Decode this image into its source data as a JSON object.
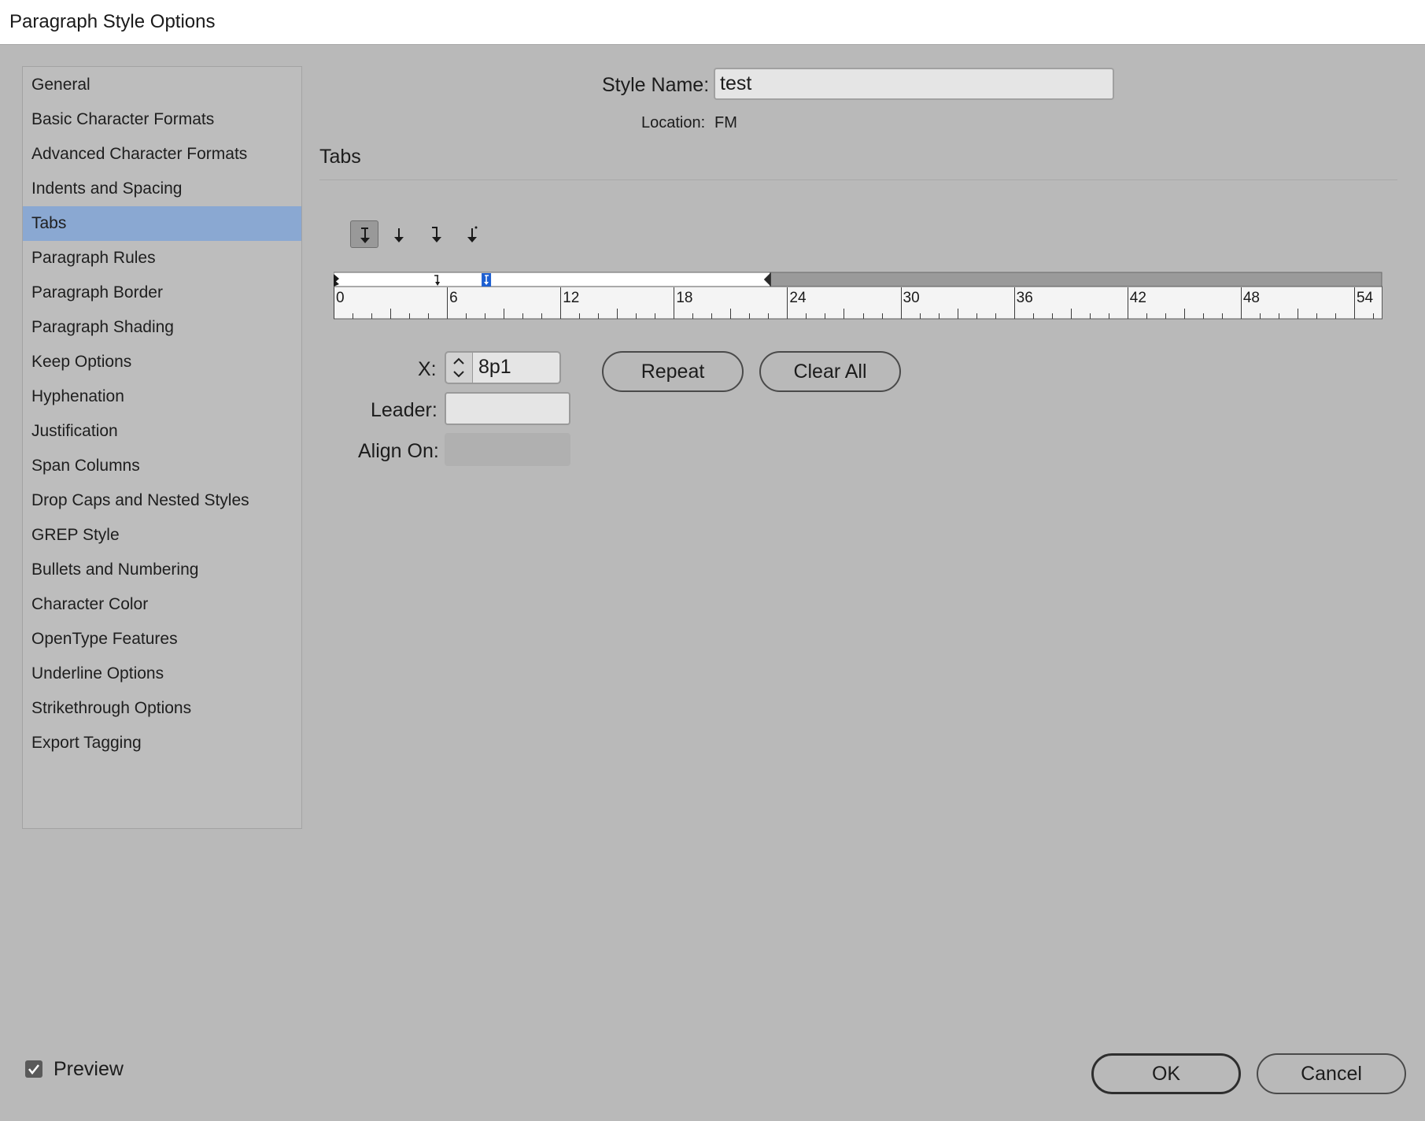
{
  "window": {
    "title": "Paragraph Style Options"
  },
  "sidebar": {
    "items": [
      {
        "label": "General",
        "selected": false
      },
      {
        "label": "Basic Character Formats",
        "selected": false
      },
      {
        "label": "Advanced Character Formats",
        "selected": false
      },
      {
        "label": "Indents and Spacing",
        "selected": false
      },
      {
        "label": "Tabs",
        "selected": true
      },
      {
        "label": "Paragraph Rules",
        "selected": false
      },
      {
        "label": "Paragraph Border",
        "selected": false
      },
      {
        "label": "Paragraph Shading",
        "selected": false
      },
      {
        "label": "Keep Options",
        "selected": false
      },
      {
        "label": "Hyphenation",
        "selected": false
      },
      {
        "label": "Justification",
        "selected": false
      },
      {
        "label": "Span Columns",
        "selected": false
      },
      {
        "label": "Drop Caps and Nested Styles",
        "selected": false
      },
      {
        "label": "GREP Style",
        "selected": false
      },
      {
        "label": "Bullets and Numbering",
        "selected": false
      },
      {
        "label": "Character Color",
        "selected": false
      },
      {
        "label": "OpenType Features",
        "selected": false
      },
      {
        "label": "Underline Options",
        "selected": false
      },
      {
        "label": "Strikethrough Options",
        "selected": false
      },
      {
        "label": "Export Tagging",
        "selected": false
      }
    ]
  },
  "header": {
    "style_name_label": "Style Name:",
    "style_name_value": "test",
    "location_label": "Location:",
    "location_value": "FM"
  },
  "section": {
    "title": "Tabs"
  },
  "tab_alignment_buttons": [
    {
      "icon": "left-justified-tab-icon",
      "active": true
    },
    {
      "icon": "center-justified-tab-icon",
      "active": false
    },
    {
      "icon": "right-justified-tab-icon",
      "active": false
    },
    {
      "icon": "align-to-decimal-tab-icon",
      "active": false
    }
  ],
  "ruler": {
    "tick_labels": [
      "0",
      "6",
      "12",
      "18",
      "24",
      "30",
      "36",
      "42",
      "48",
      "54"
    ],
    "max": 55.5,
    "right_indent": 23.1,
    "tab_stops": [
      {
        "position": 5.5,
        "type": "right",
        "selected": false
      },
      {
        "position": 8.08,
        "type": "left",
        "selected": true
      }
    ]
  },
  "controls": {
    "x_label": "X:",
    "x_value": "8p1",
    "leader_label": "Leader:",
    "leader_value": "",
    "align_on_label": "Align On:",
    "align_on_value": "",
    "repeat_label": "Repeat",
    "clear_all_label": "Clear All"
  },
  "footer": {
    "preview_label": "Preview",
    "preview_checked": true,
    "ok_label": "OK",
    "cancel_label": "Cancel"
  },
  "colors": {
    "dialog_bg": "#b9b9b9",
    "selected_item": "#8aa8d2",
    "selected_tab_marker": "#1d5fd1"
  }
}
